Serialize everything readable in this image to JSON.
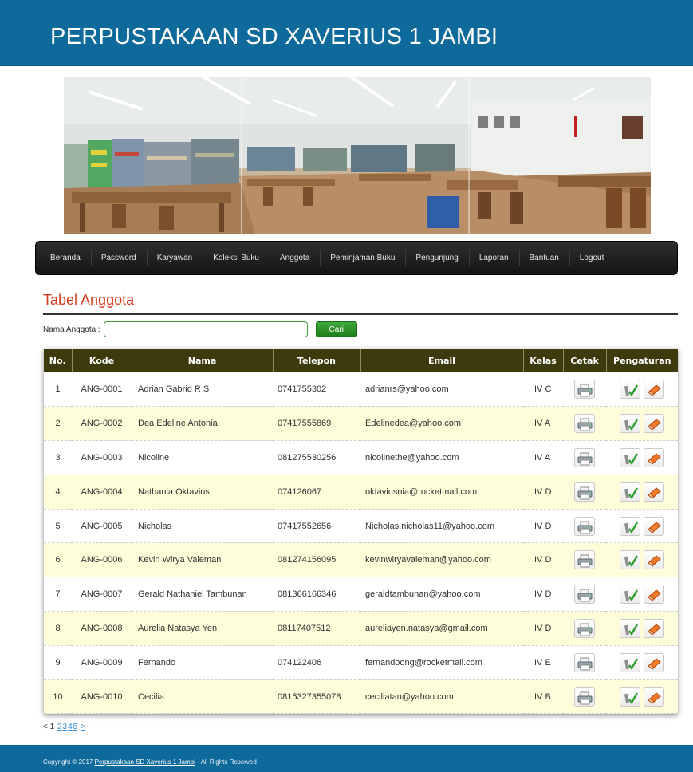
{
  "site_title": "PERPUSTAKAAN SD XAVERIUS 1 JAMBI",
  "nav": [
    "Beranda",
    "Password",
    "Karyawan",
    "Koleksi Buku",
    "Anggota",
    "Peminjaman Buku",
    "Pengunjung",
    "Laporan",
    "Bantuan",
    "Logout"
  ],
  "page_title": "Tabel Anggota",
  "search": {
    "label": "Nama Anggota :",
    "value": "",
    "button": "Cari"
  },
  "table": {
    "headers": [
      "No.",
      "Kode",
      "Nama",
      "Telepon",
      "Email",
      "Kelas",
      "Cetak",
      "Pengaturan"
    ],
    "rows": [
      {
        "no": "1",
        "kode": "ANG-0001",
        "nama": "Adrian Gabrid R S",
        "telepon": "0741755302",
        "email": "adrianrs@yahoo.com",
        "kelas": "IV C"
      },
      {
        "no": "2",
        "kode": "ANG-0002",
        "nama": "Dea Edeline Antonia",
        "telepon": "07417555869",
        "email": "Edelinedea@yahoo.com",
        "kelas": "IV A"
      },
      {
        "no": "3",
        "kode": "ANG-0003",
        "nama": "Nicoline",
        "telepon": "081275530256",
        "email": "nicolinethe@yahoo.com",
        "kelas": "IV A"
      },
      {
        "no": "4",
        "kode": "ANG-0004",
        "nama": "Nathania Oktavius",
        "telepon": "074126067",
        "email": "oktaviusnia@rocketmail.com",
        "kelas": "IV D"
      },
      {
        "no": "5",
        "kode": "ANG-0005",
        "nama": "Nicholas",
        "telepon": "07417552656",
        "email": "Nicholas.nicholas11@yahoo.com",
        "kelas": "IV D"
      },
      {
        "no": "6",
        "kode": "ANG-0006",
        "nama": "Kevin Wirya Valeman",
        "telepon": "081274156095",
        "email": "kevinwiryavaleman@yahoo.com",
        "kelas": "IV D"
      },
      {
        "no": "7",
        "kode": "ANG-0007",
        "nama": "Gerald Nathaniel Tambunan",
        "telepon": "081366166346",
        "email": "geraldtambunan@yahoo.com",
        "kelas": "IV D"
      },
      {
        "no": "8",
        "kode": "ANG-0008",
        "nama": "Aurelia Natasya Yen",
        "telepon": "08117407512",
        "email": "aureliayen.natasya@gmail.com",
        "kelas": "IV D"
      },
      {
        "no": "9",
        "kode": "ANG-0009",
        "nama": "Fernando",
        "telepon": "074122406",
        "email": "fernandoong@rocketmail.com",
        "kelas": "IV E"
      },
      {
        "no": "10",
        "kode": "ANG-0010",
        "nama": "Cecilia",
        "telepon": "0815327355078",
        "email": "ceciliatan@yahoo.com",
        "kelas": "IV B"
      }
    ]
  },
  "pagination": {
    "prev": "<",
    "current": "1",
    "pages": [
      "2",
      "3",
      "4",
      "5"
    ],
    "next": ">"
  },
  "footer": {
    "prefix": "Copyright © 2017 ",
    "link": "Perpustakaan SD Xaverius 1 Jambi",
    "suffix": " - All Rights Reserved"
  },
  "icons": {
    "print": "printer-icon",
    "edit": "edit-check-icon",
    "delete": "eraser-delete-icon"
  },
  "colors": {
    "header": "#0f6a9c",
    "title": "#d33b1f",
    "table_header": "#3d3b0d",
    "row_alt": "#fdfdd9",
    "search_button": "#2a8f27"
  }
}
